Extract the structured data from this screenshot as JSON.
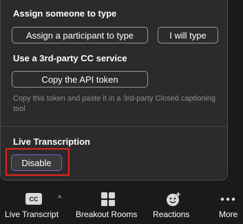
{
  "popup": {
    "assign_title": "Assign someone to type",
    "assign_participant_label": "Assign a participant to type",
    "i_will_type_label": "I will type",
    "third_party_title": "Use a 3rd-party CC service",
    "copy_token_label": "Copy the API token",
    "hint_text": "Copy this token and paste it in a 3rd-party Closed captioning tool",
    "live_transcription_title": "Live Transcription",
    "disable_label": "Disable"
  },
  "toolbar": {
    "live_transcript": {
      "label": "Live Transcript",
      "icon_text": "CC",
      "chevron": "^"
    },
    "breakout_rooms": {
      "label": "Breakout Rooms"
    },
    "reactions": {
      "label": "Reactions"
    },
    "more": {
      "label": "More"
    }
  },
  "colors": {
    "popup_bg": "#2b2b2d",
    "highlight_red": "#e5231b",
    "disable_border": "#8a5cc9"
  }
}
